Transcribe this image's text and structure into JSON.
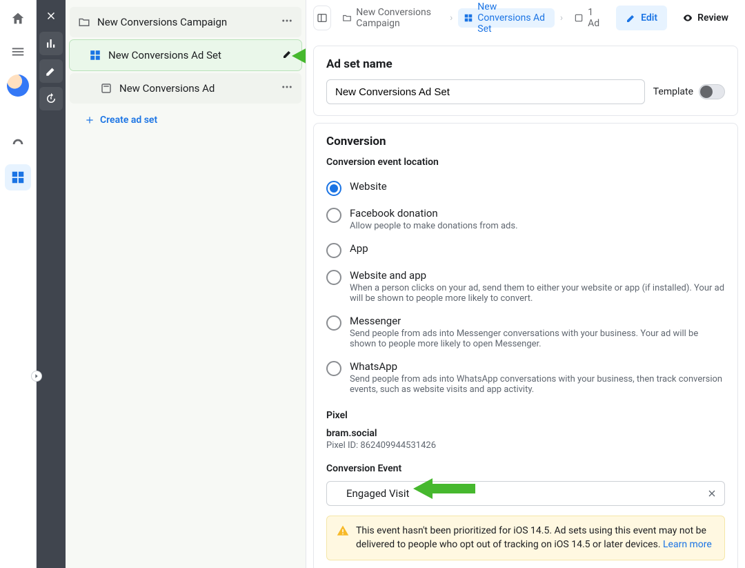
{
  "tree": {
    "campaign": "New Conversions Campaign",
    "adset": "New Conversions Ad Set",
    "ad": "New Conversions Ad",
    "create": "Create ad set"
  },
  "crumbs": {
    "campaign": "New Conversions Campaign",
    "adset": "New Conversions Ad Set",
    "ad": "1 Ad"
  },
  "actions": {
    "edit": "Edit",
    "review": "Review"
  },
  "adset_name": {
    "heading": "Ad set name",
    "value": "New Conversions Ad Set",
    "template_label": "Template"
  },
  "conversion": {
    "heading": "Conversion",
    "location_label": "Conversion event location",
    "opts": {
      "website": {
        "title": "Website"
      },
      "donation": {
        "title": "Facebook donation",
        "desc": "Allow people to make donations from ads."
      },
      "app": {
        "title": "App"
      },
      "webapp": {
        "title": "Website and app",
        "desc": "When a person clicks on your ad, send them to either your website or app (if installed). Your ad will be shown to people more likely to convert."
      },
      "messenger": {
        "title": "Messenger",
        "desc": "Send people from ads into Messenger conversations with your business. Your ad will be shown to people more likely to open Messenger."
      },
      "whatsapp": {
        "title": "WhatsApp",
        "desc": "Send people from ads into WhatsApp conversations with your business, then track conversion events, such as website visits and app activity."
      }
    },
    "pixel_label": "Pixel",
    "pixel_name": "bram.social",
    "pixel_id": "Pixel ID: 862409944531426",
    "event_label": "Conversion Event",
    "event_value": "Engaged Visit",
    "warning": "This event hasn't been prioritized for iOS 14.5. Ad sets using this event may not be delivered to people who opt out of tracking on iOS 14.5 or later devices. ",
    "learn_more": "Learn more"
  }
}
